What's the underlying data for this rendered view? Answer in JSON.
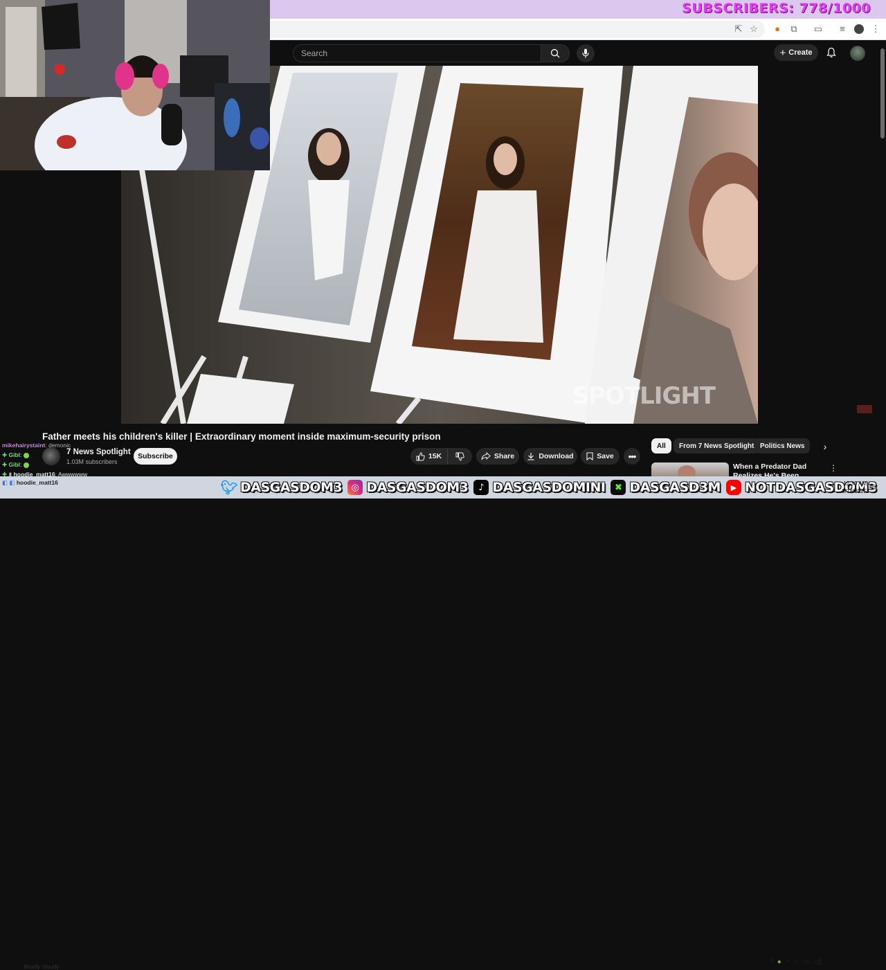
{
  "overlay": {
    "subscriber_goal": "SUBSCRIBERS: 778/1000"
  },
  "youtube": {
    "search": {
      "placeholder": "Search"
    },
    "create_label": "Create",
    "video": {
      "title": "Father meets his children's killer | Extraordinary moment inside maximum-security prison",
      "watermark": "SPOTLIGHT"
    },
    "channel": {
      "name": "7 News Spotlight",
      "subscribers": "1.03M subscribers",
      "subscribe_label": "Subscribe"
    },
    "actions": {
      "like_count": "15K",
      "share_label": "Share",
      "download_label": "Download",
      "save_label": "Save"
    },
    "chips": [
      "All",
      "From 7 News Spotlight",
      "Politics News"
    ],
    "recommended": {
      "title": "When a Predator Dad Realizes He's Been Caught"
    }
  },
  "chat": [
    {
      "user": "mikehairystaint",
      "message": ": demonic",
      "color": "#c98bd6"
    },
    {
      "user": "Gibl",
      "message": ":",
      "color": "#6fe36f"
    },
    {
      "user": "Gibl",
      "message": ":",
      "color": "#6fe36f"
    },
    {
      "user": "hoodie_matt16",
      "message": ": Awwwwww",
      "color": "#e8e8e8"
    },
    {
      "user": "hoodie_matt16",
      "message": "",
      "color": "#e8e8e8"
    }
  ],
  "social": [
    {
      "platform": "twitter-icon",
      "handle": "DASGASDOM3",
      "color": "#1d9bf0"
    },
    {
      "platform": "instagram-icon",
      "handle": "DASGASDOM3",
      "color": "#d62976"
    },
    {
      "platform": "tiktok-icon",
      "handle": "DASGASDOMINI",
      "color": "#000000"
    },
    {
      "platform": "kick-icon",
      "handle": "DASGASD3M",
      "color": "#53fc18"
    },
    {
      "platform": "youtube-icon",
      "handle": "NOTDASGASDOM3",
      "color": "#ff0000"
    }
  ],
  "taskbar": {
    "weather": "Mostly cloudy",
    "time": "12:30 AM",
    "date": "8/18/2025"
  }
}
